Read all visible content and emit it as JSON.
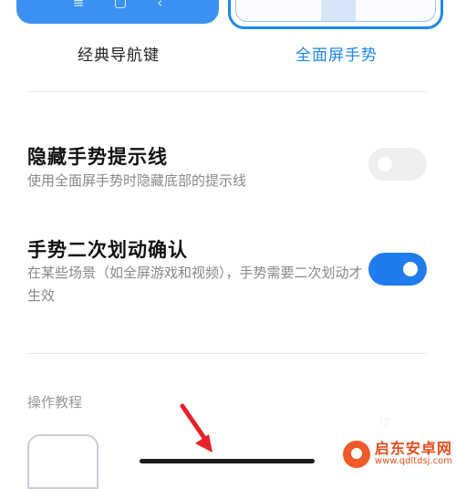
{
  "nav_options": {
    "classic": {
      "label": "经典导航键",
      "selected": false,
      "icons": [
        "menu-icon",
        "square-icon",
        "back-icon"
      ]
    },
    "gesture": {
      "label": "全面屏手势",
      "selected": true
    }
  },
  "settings": [
    {
      "title": "隐藏手势提示线",
      "description": "使用全面屏手势时隐藏底部的提示线",
      "enabled": false
    },
    {
      "title": "手势二次划动确认",
      "description": "在某些场景（如全屏游戏和视频），手势需要二次划动才生效",
      "enabled": true
    }
  ],
  "tutorial": {
    "header": "操作教程"
  },
  "watermark": {
    "name": "启东安卓网",
    "url": "www.qdltdsj.com"
  },
  "colors": {
    "accent": "#1f7cef",
    "arrow": "#e8202a"
  }
}
